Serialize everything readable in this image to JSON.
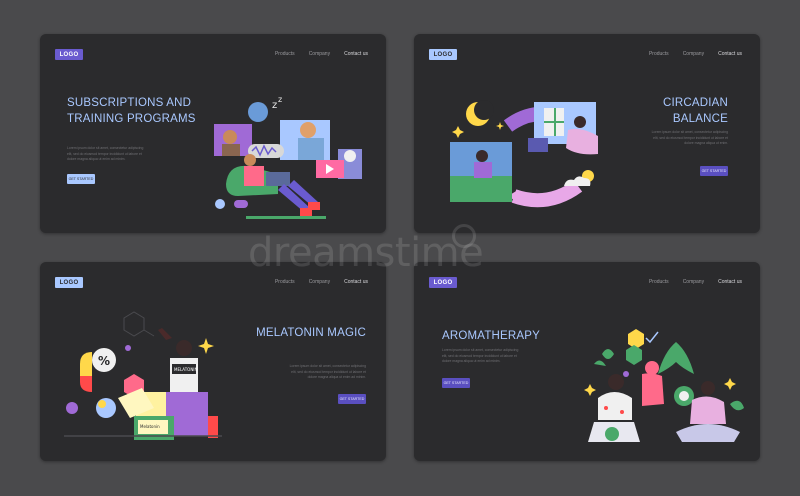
{
  "colors": {
    "background": "#4a4a4c",
    "card": "#2b2b2d",
    "logo_purple": "#6a5bcf",
    "logo_blue": "#a9c8ff",
    "title": "#a9c8ff",
    "cta_purple": "#5a4fc0",
    "cta_blue": "#a9c8ff"
  },
  "nav": [
    "Products",
    "Company",
    "Contact us"
  ],
  "cards": [
    {
      "logo": "LOGO",
      "title": "SUBSCRIPTIONS AND TRAINING PROGRAMS",
      "description": "Lorem ipsum dolor sit amet, consectetur adipiscing elit, sed do eiusmod tempor incididunt ut labore et dolore magna aliqua ut enim ad minim.",
      "cta": "GET STARTED",
      "illustration": "people-watching-video-call-icon"
    },
    {
      "logo": "LOGO",
      "title": "CIRCADIAN BALANCE",
      "description": "Lorem ipsum dolor sit amet, consectetur adipiscing elit, sed do eiusmod tempor incididunt ut labore et dolore magna aliqua ut enim.",
      "cta": "GET STARTED",
      "illustration": "day-night-cycle-icon"
    },
    {
      "logo": "LOGO",
      "title": "MELATONIN MAGIC",
      "description": "Lorem ipsum dolor sit amet, consectetur adipiscing elit, sed do eiusmod tempor incididunt ut labore et dolore magna aliqua ut enim ad minim.",
      "cta": "GET STARTED",
      "illustration": "melatonin-supplement-icon",
      "pill_label": "%",
      "box_label_1": "MELATONIN",
      "box_label_2": "Melatonin"
    },
    {
      "logo": "LOGO",
      "title": "AROMATHERAPY",
      "description": "Lorem ipsum dolor sit amet, consectetur adipiscing elit, sed do eiusmod tempor incididunt ut labore et dolore magna aliqua ut enim ad minim.",
      "cta": "GET STARTED",
      "illustration": "aromatherapy-people-icon"
    }
  ],
  "watermark": "dreamstime"
}
